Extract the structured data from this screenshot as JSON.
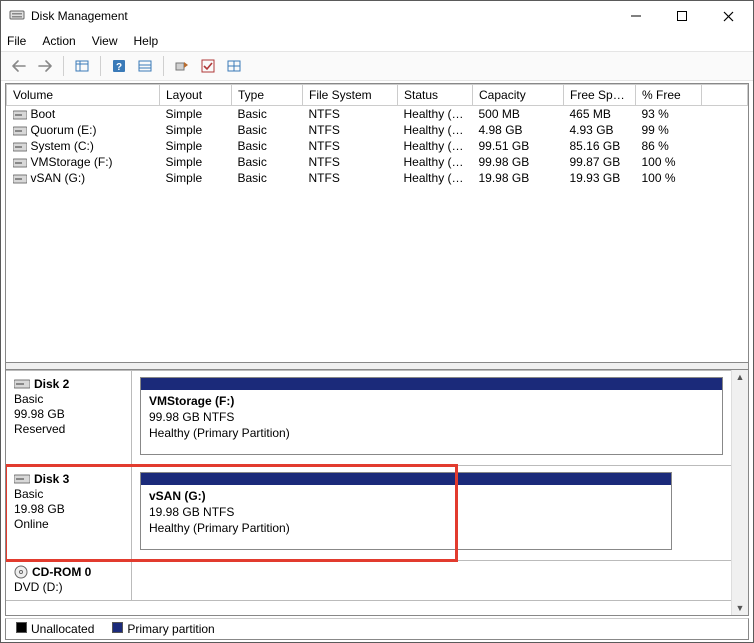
{
  "window": {
    "title": "Disk Management"
  },
  "menu": {
    "file": "File",
    "action": "Action",
    "view": "View",
    "help": "Help"
  },
  "columns": {
    "volume": "Volume",
    "layout": "Layout",
    "type": "Type",
    "filesystem": "File System",
    "status": "Status",
    "capacity": "Capacity",
    "freespace": "Free Spa...",
    "pctfree": "% Free"
  },
  "volumes": [
    {
      "name": "Boot",
      "layout": "Simple",
      "type": "Basic",
      "fs": "NTFS",
      "status": "Healthy (S...",
      "capacity": "500 MB",
      "free": "465 MB",
      "pct": "93 %"
    },
    {
      "name": "Quorum (E:)",
      "layout": "Simple",
      "type": "Basic",
      "fs": "NTFS",
      "status": "Healthy (P...",
      "capacity": "4.98 GB",
      "free": "4.93 GB",
      "pct": "99 %"
    },
    {
      "name": "System (C:)",
      "layout": "Simple",
      "type": "Basic",
      "fs": "NTFS",
      "status": "Healthy (B...",
      "capacity": "99.51 GB",
      "free": "85.16 GB",
      "pct": "86 %"
    },
    {
      "name": "VMStorage (F:)",
      "layout": "Simple",
      "type": "Basic",
      "fs": "NTFS",
      "status": "Healthy (P...",
      "capacity": "99.98 GB",
      "free": "99.87 GB",
      "pct": "100 %"
    },
    {
      "name": "vSAN (G:)",
      "layout": "Simple",
      "type": "Basic",
      "fs": "NTFS",
      "status": "Healthy (P...",
      "capacity": "19.98 GB",
      "free": "19.93 GB",
      "pct": "100 %"
    }
  ],
  "disks": {
    "disk2": {
      "title": "Disk 2",
      "type": "Basic",
      "size": "99.98 GB",
      "state": "Reserved",
      "part": {
        "name": "VMStorage  (F:)",
        "line2": "99.98 GB NTFS",
        "line3": "Healthy (Primary Partition)"
      }
    },
    "disk3": {
      "title": "Disk 3",
      "type": "Basic",
      "size": "19.98 GB",
      "state": "Online",
      "part": {
        "name": "vSAN  (G:)",
        "line2": "19.98 GB NTFS",
        "line3": "Healthy (Primary Partition)"
      }
    },
    "cdrom": {
      "title": "CD-ROM 0",
      "type": "DVD (D:)"
    }
  },
  "legend": {
    "unallocated": "Unallocated",
    "primary": "Primary partition"
  }
}
